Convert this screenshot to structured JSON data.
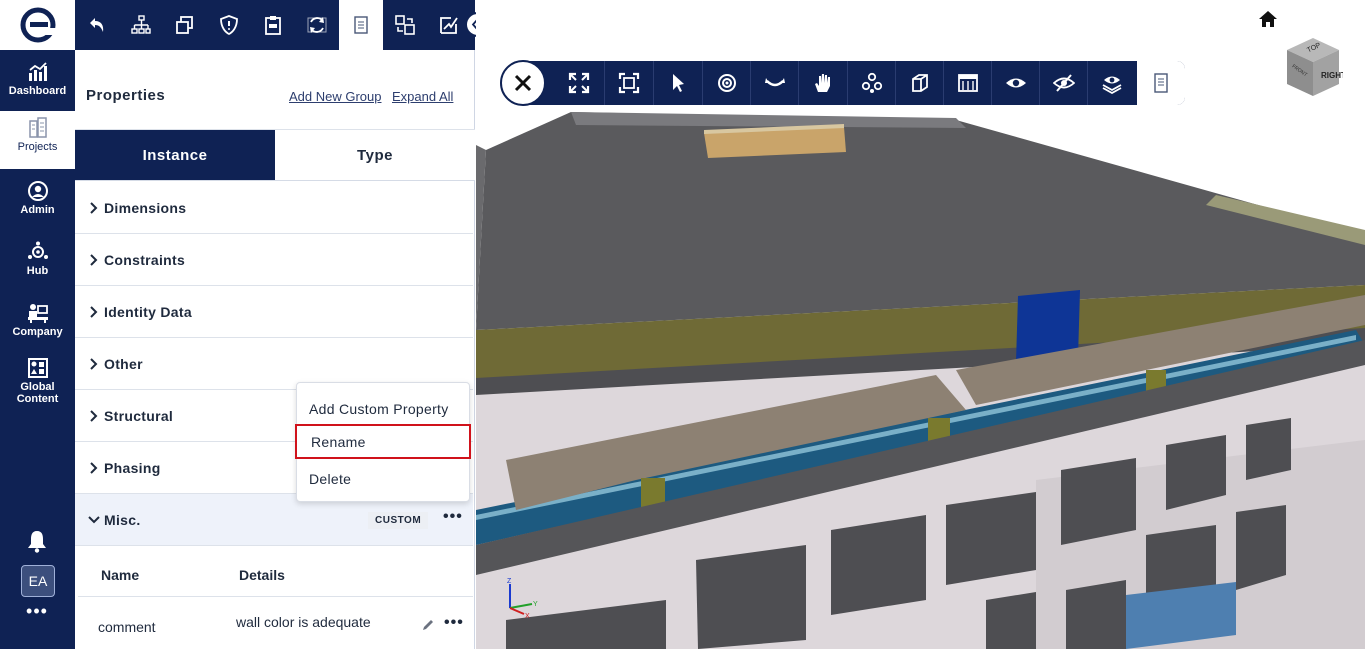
{
  "nav": {
    "items": [
      {
        "label": "Dashboard"
      },
      {
        "label": "Projects"
      },
      {
        "label": "Admin"
      },
      {
        "label": "Hub"
      },
      {
        "label": "Company"
      },
      {
        "label": "Global Content"
      }
    ],
    "avatar": "EA",
    "more": "•••"
  },
  "panel": {
    "title": "Properties",
    "add_group": "Add New Group",
    "expand_all": "Expand All",
    "tabs": [
      "Instance",
      "Type"
    ],
    "sections": [
      "Dimensions",
      "Constraints",
      "Identity Data",
      "Other",
      "Structural",
      "Phasing",
      "Misc."
    ],
    "misc_badge": "CUSTOM",
    "table": {
      "headers": [
        "Name",
        "Details"
      ],
      "rows": [
        {
          "name": "comment",
          "details": "wall color is adequate"
        }
      ]
    }
  },
  "context_menu": {
    "items": [
      "Add Custom Property",
      "Rename",
      "Delete"
    ],
    "highlighted": "Rename"
  },
  "viewer": {
    "cube_labels": [
      "RIGHT",
      "TOP",
      "FRONT"
    ],
    "axes": [
      "X",
      "Y",
      "Z"
    ]
  },
  "colors": {
    "navy": "#0f2254",
    "highlight": "#d0121b"
  }
}
